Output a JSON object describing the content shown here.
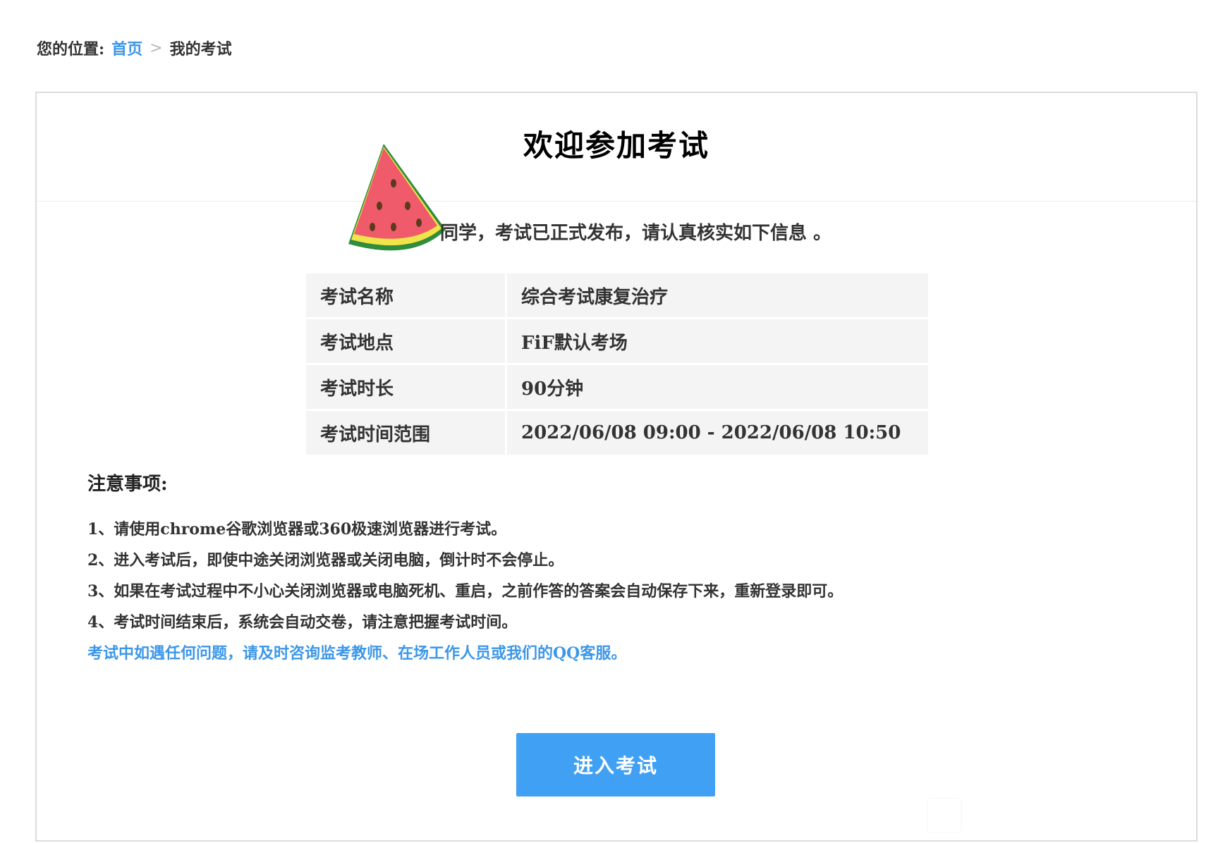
{
  "breadcrumb": {
    "prefix": "您的位置:",
    "home": "首页",
    "separator": ">",
    "current": "我的考试"
  },
  "exam": {
    "title": "欢迎参加考试",
    "intro": "同学，考试已正式发布，请认真核实如下信息 。",
    "info": [
      {
        "label": "考试名称",
        "value": "综合考试康复治疗"
      },
      {
        "label": "考试地点",
        "value": "FiF默认考场"
      },
      {
        "label": "考试时长",
        "value": "90分钟"
      },
      {
        "label": "考试时间范围",
        "value": "2022/06/08 09:00 - 2022/06/08 10:50"
      }
    ]
  },
  "notes": {
    "title": "注意事项:",
    "items": [
      "1、请使用chrome谷歌浏览器或360极速浏览器进行考试。",
      "2、进入考试后，即使中途关闭浏览器或关闭电脑，倒计时不会停止。",
      "3、如果在考试过程中不小心关闭浏览器或电脑死机、重启，之前作答的答案会自动保存下来，重新登录即可。",
      "4、考试时间结束后，系统会自动交卷，请注意把握考试时间。"
    ],
    "help": "考试中如遇任何问题，请及时咨询监考教师、在场工作人员或我们的QQ客服。"
  },
  "actions": {
    "enter_label": "进入考试"
  },
  "colors": {
    "accent": "#3c97e8",
    "button": "#40a0f4",
    "table_bg": "#f4f4f4"
  }
}
